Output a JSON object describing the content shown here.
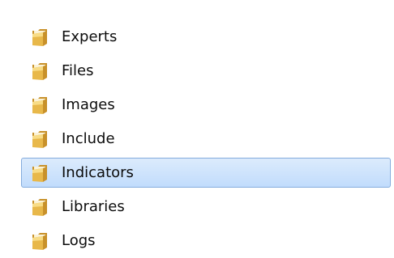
{
  "folders": [
    {
      "label": "Experts",
      "icon": "folder-icon",
      "selected": false
    },
    {
      "label": "Files",
      "icon": "folder-icon",
      "selected": false
    },
    {
      "label": "Images",
      "icon": "folder-icon",
      "selected": false
    },
    {
      "label": "Include",
      "icon": "folder-icon",
      "selected": false
    },
    {
      "label": "Indicators",
      "icon": "folder-icon",
      "selected": true
    },
    {
      "label": "Libraries",
      "icon": "folder-icon",
      "selected": false
    },
    {
      "label": "Logs",
      "icon": "folder-icon",
      "selected": false
    }
  ],
  "colors": {
    "folder_body": "#e8b84a",
    "folder_light": "#f8dc86",
    "folder_dark": "#c8912a",
    "folder_paper": "#fbf3d8",
    "selection_border": "#84acdd",
    "selection_top": "#dcebfc",
    "selection_bottom": "#c1dcfc",
    "text": "#0c0c0c"
  }
}
